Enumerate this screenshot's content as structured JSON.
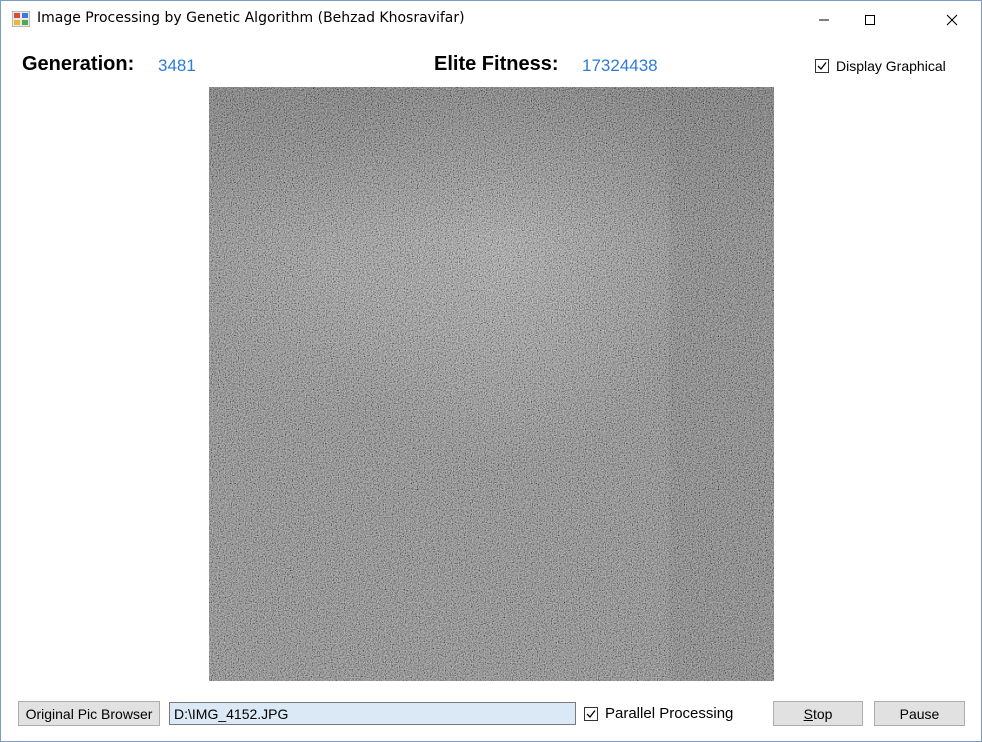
{
  "window": {
    "title": "Image Processing by Genetic Algorithm (Behzad Khosravifar)",
    "icons": [
      "app-icon",
      "minimize-icon",
      "maximize-icon",
      "close-icon"
    ]
  },
  "stats": {
    "generation_label": "Generation:",
    "generation_value": "3481",
    "fitness_label": "Elite Fitness:",
    "fitness_value": "17324438",
    "value_color": "#2e7bd6"
  },
  "options": {
    "display_graphical_label": "Display Graphical",
    "display_graphical_checked": true,
    "parallel_processing_label": "Parallel Processing",
    "parallel_processing_checked": true
  },
  "canvas": {
    "content": "grayscale-noise-image"
  },
  "controls": {
    "browse_label": "Original Pic Browser",
    "path_value": "D:\\IMG_4152.JPG",
    "stop_label": "Stop",
    "pause_label": "Pause"
  }
}
